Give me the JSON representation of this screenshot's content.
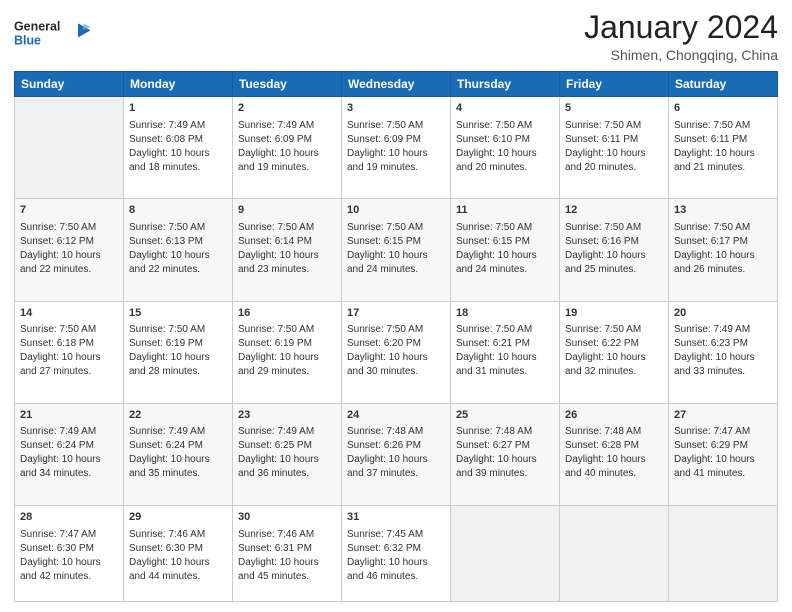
{
  "header": {
    "logo_line1": "General",
    "logo_line2": "Blue",
    "month_year": "January 2024",
    "location": "Shimen, Chongqing, China"
  },
  "weekdays": [
    "Sunday",
    "Monday",
    "Tuesday",
    "Wednesday",
    "Thursday",
    "Friday",
    "Saturday"
  ],
  "weeks": [
    [
      {
        "day": "",
        "info": ""
      },
      {
        "day": "1",
        "info": "Sunrise: 7:49 AM\nSunset: 6:08 PM\nDaylight: 10 hours\nand 18 minutes."
      },
      {
        "day": "2",
        "info": "Sunrise: 7:49 AM\nSunset: 6:09 PM\nDaylight: 10 hours\nand 19 minutes."
      },
      {
        "day": "3",
        "info": "Sunrise: 7:50 AM\nSunset: 6:09 PM\nDaylight: 10 hours\nand 19 minutes."
      },
      {
        "day": "4",
        "info": "Sunrise: 7:50 AM\nSunset: 6:10 PM\nDaylight: 10 hours\nand 20 minutes."
      },
      {
        "day": "5",
        "info": "Sunrise: 7:50 AM\nSunset: 6:11 PM\nDaylight: 10 hours\nand 20 minutes."
      },
      {
        "day": "6",
        "info": "Sunrise: 7:50 AM\nSunset: 6:11 PM\nDaylight: 10 hours\nand 21 minutes."
      }
    ],
    [
      {
        "day": "7",
        "info": "Sunrise: 7:50 AM\nSunset: 6:12 PM\nDaylight: 10 hours\nand 22 minutes."
      },
      {
        "day": "8",
        "info": "Sunrise: 7:50 AM\nSunset: 6:13 PM\nDaylight: 10 hours\nand 22 minutes."
      },
      {
        "day": "9",
        "info": "Sunrise: 7:50 AM\nSunset: 6:14 PM\nDaylight: 10 hours\nand 23 minutes."
      },
      {
        "day": "10",
        "info": "Sunrise: 7:50 AM\nSunset: 6:15 PM\nDaylight: 10 hours\nand 24 minutes."
      },
      {
        "day": "11",
        "info": "Sunrise: 7:50 AM\nSunset: 6:15 PM\nDaylight: 10 hours\nand 24 minutes."
      },
      {
        "day": "12",
        "info": "Sunrise: 7:50 AM\nSunset: 6:16 PM\nDaylight: 10 hours\nand 25 minutes."
      },
      {
        "day": "13",
        "info": "Sunrise: 7:50 AM\nSunset: 6:17 PM\nDaylight: 10 hours\nand 26 minutes."
      }
    ],
    [
      {
        "day": "14",
        "info": "Sunrise: 7:50 AM\nSunset: 6:18 PM\nDaylight: 10 hours\nand 27 minutes."
      },
      {
        "day": "15",
        "info": "Sunrise: 7:50 AM\nSunset: 6:19 PM\nDaylight: 10 hours\nand 28 minutes."
      },
      {
        "day": "16",
        "info": "Sunrise: 7:50 AM\nSunset: 6:19 PM\nDaylight: 10 hours\nand 29 minutes."
      },
      {
        "day": "17",
        "info": "Sunrise: 7:50 AM\nSunset: 6:20 PM\nDaylight: 10 hours\nand 30 minutes."
      },
      {
        "day": "18",
        "info": "Sunrise: 7:50 AM\nSunset: 6:21 PM\nDaylight: 10 hours\nand 31 minutes."
      },
      {
        "day": "19",
        "info": "Sunrise: 7:50 AM\nSunset: 6:22 PM\nDaylight: 10 hours\nand 32 minutes."
      },
      {
        "day": "20",
        "info": "Sunrise: 7:49 AM\nSunset: 6:23 PM\nDaylight: 10 hours\nand 33 minutes."
      }
    ],
    [
      {
        "day": "21",
        "info": "Sunrise: 7:49 AM\nSunset: 6:24 PM\nDaylight: 10 hours\nand 34 minutes."
      },
      {
        "day": "22",
        "info": "Sunrise: 7:49 AM\nSunset: 6:24 PM\nDaylight: 10 hours\nand 35 minutes."
      },
      {
        "day": "23",
        "info": "Sunrise: 7:49 AM\nSunset: 6:25 PM\nDaylight: 10 hours\nand 36 minutes."
      },
      {
        "day": "24",
        "info": "Sunrise: 7:48 AM\nSunset: 6:26 PM\nDaylight: 10 hours\nand 37 minutes."
      },
      {
        "day": "25",
        "info": "Sunrise: 7:48 AM\nSunset: 6:27 PM\nDaylight: 10 hours\nand 39 minutes."
      },
      {
        "day": "26",
        "info": "Sunrise: 7:48 AM\nSunset: 6:28 PM\nDaylight: 10 hours\nand 40 minutes."
      },
      {
        "day": "27",
        "info": "Sunrise: 7:47 AM\nSunset: 6:29 PM\nDaylight: 10 hours\nand 41 minutes."
      }
    ],
    [
      {
        "day": "28",
        "info": "Sunrise: 7:47 AM\nSunset: 6:30 PM\nDaylight: 10 hours\nand 42 minutes."
      },
      {
        "day": "29",
        "info": "Sunrise: 7:46 AM\nSunset: 6:30 PM\nDaylight: 10 hours\nand 44 minutes."
      },
      {
        "day": "30",
        "info": "Sunrise: 7:46 AM\nSunset: 6:31 PM\nDaylight: 10 hours\nand 45 minutes."
      },
      {
        "day": "31",
        "info": "Sunrise: 7:45 AM\nSunset: 6:32 PM\nDaylight: 10 hours\nand 46 minutes."
      },
      {
        "day": "",
        "info": ""
      },
      {
        "day": "",
        "info": ""
      },
      {
        "day": "",
        "info": ""
      }
    ]
  ]
}
